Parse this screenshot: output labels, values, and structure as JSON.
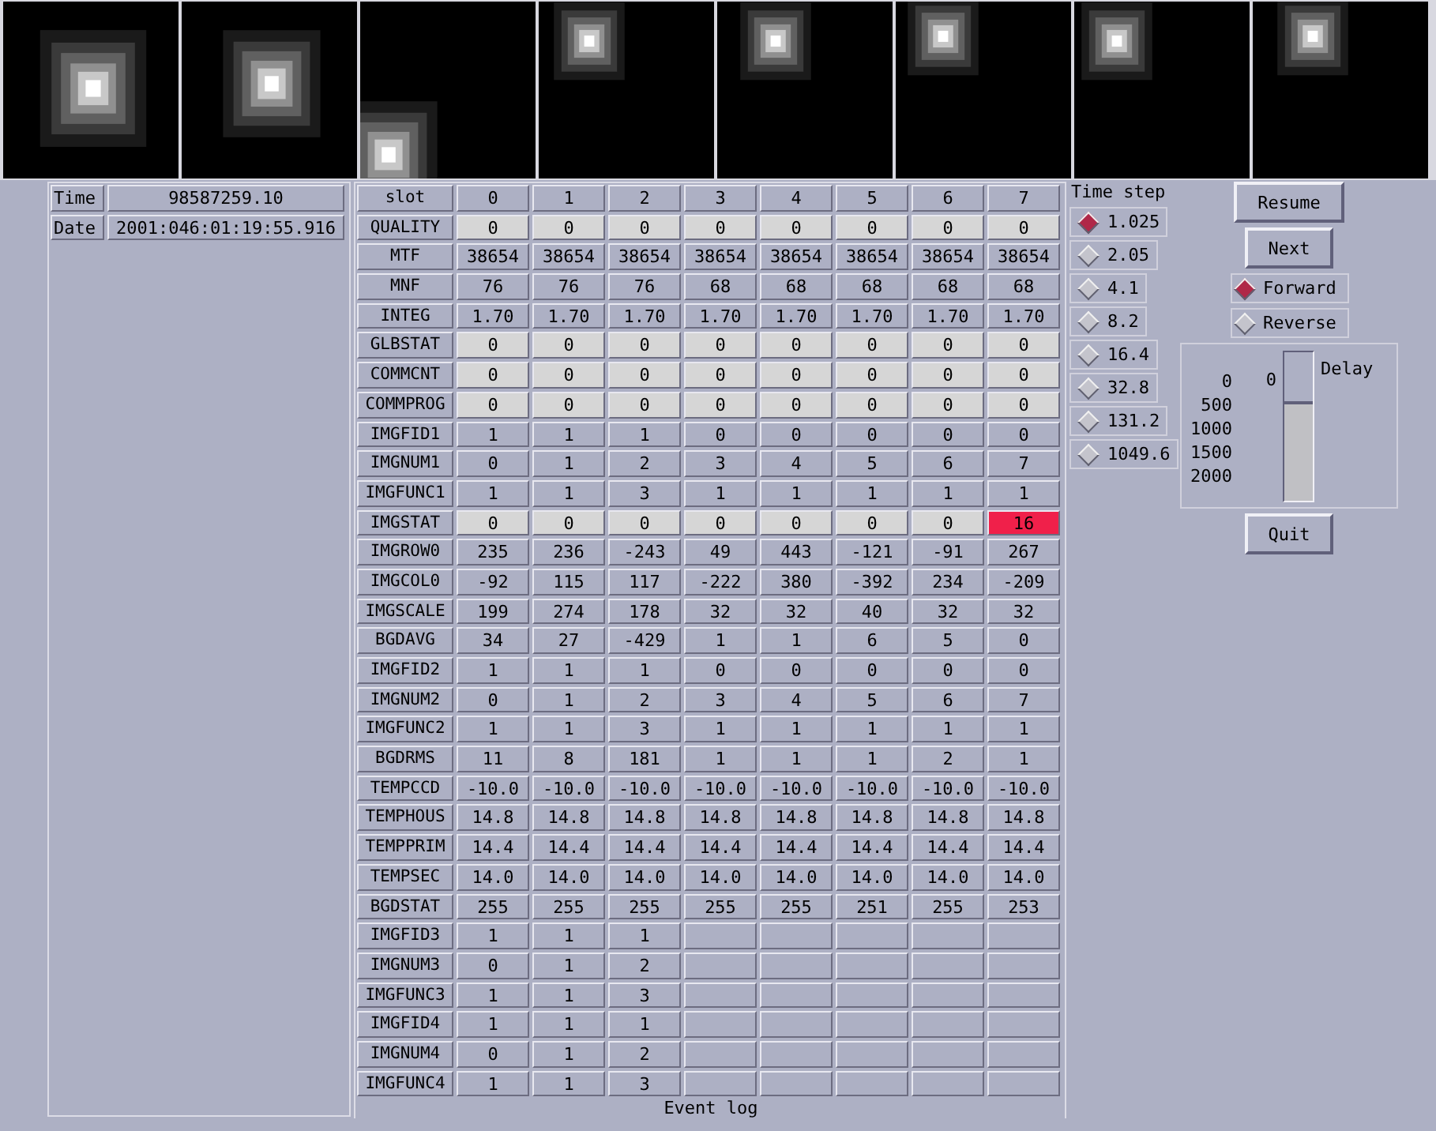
{
  "images": [
    {
      "kind": "picture"
    },
    {
      "kind": "picture"
    },
    {
      "kind": "picture"
    },
    {
      "kind": "picture"
    },
    {
      "kind": "picture"
    },
    {
      "kind": "picture"
    },
    {
      "kind": "picture"
    },
    {
      "kind": "picture"
    }
  ],
  "info": [
    {
      "label": "Time",
      "value": "98587259.10"
    },
    {
      "label": "Date",
      "value": "2001:046:01:19:55.916"
    }
  ],
  "table": {
    "header": {
      "label": "slot",
      "cells": [
        "0",
        "1",
        "2",
        "3",
        "4",
        "5",
        "6",
        "7"
      ]
    },
    "rows": [
      {
        "label": "QUALITY",
        "kind": "status",
        "cells": [
          {
            "text": "0",
            "alarm": false
          },
          {
            "text": "0",
            "alarm": false
          },
          {
            "text": "0",
            "alarm": false
          },
          {
            "text": "0",
            "alarm": false
          },
          {
            "text": "0",
            "alarm": false
          },
          {
            "text": "0",
            "alarm": false
          },
          {
            "text": "0",
            "alarm": false
          },
          {
            "text": "0",
            "alarm": false
          }
        ]
      },
      {
        "label": "MTF",
        "kind": "value",
        "cells": [
          "38654",
          "38654",
          "38654",
          "38654",
          "38654",
          "38654",
          "38654",
          "38654"
        ]
      },
      {
        "label": "MNF",
        "kind": "value",
        "cells": [
          "76",
          "76",
          "76",
          "68",
          "68",
          "68",
          "68",
          "68"
        ]
      },
      {
        "label": "INTEG",
        "kind": "value",
        "cells": [
          "1.70",
          "1.70",
          "1.70",
          "1.70",
          "1.70",
          "1.70",
          "1.70",
          "1.70"
        ]
      },
      {
        "label": "GLBSTAT",
        "kind": "status",
        "cells": [
          {
            "text": "0",
            "alarm": false
          },
          {
            "text": "0",
            "alarm": false
          },
          {
            "text": "0",
            "alarm": false
          },
          {
            "text": "0",
            "alarm": false
          },
          {
            "text": "0",
            "alarm": false
          },
          {
            "text": "0",
            "alarm": false
          },
          {
            "text": "0",
            "alarm": false
          },
          {
            "text": "0",
            "alarm": false
          }
        ]
      },
      {
        "label": "COMMCNT",
        "kind": "status",
        "cells": [
          {
            "text": "0",
            "alarm": false
          },
          {
            "text": "0",
            "alarm": false
          },
          {
            "text": "0",
            "alarm": false
          },
          {
            "text": "0",
            "alarm": false
          },
          {
            "text": "0",
            "alarm": false
          },
          {
            "text": "0",
            "alarm": false
          },
          {
            "text": "0",
            "alarm": false
          },
          {
            "text": "0",
            "alarm": false
          }
        ]
      },
      {
        "label": "COMMPROG",
        "kind": "status",
        "cells": [
          {
            "text": "0",
            "alarm": false
          },
          {
            "text": "0",
            "alarm": false
          },
          {
            "text": "0",
            "alarm": false
          },
          {
            "text": "0",
            "alarm": false
          },
          {
            "text": "0",
            "alarm": false
          },
          {
            "text": "0",
            "alarm": false
          },
          {
            "text": "0",
            "alarm": false
          },
          {
            "text": "0",
            "alarm": false
          }
        ]
      },
      {
        "label": "IMGFID1",
        "kind": "value",
        "cells": [
          "1",
          "1",
          "1",
          "0",
          "0",
          "0",
          "0",
          "0"
        ]
      },
      {
        "label": "IMGNUM1",
        "kind": "value",
        "cells": [
          "0",
          "1",
          "2",
          "3",
          "4",
          "5",
          "6",
          "7"
        ]
      },
      {
        "label": "IMGFUNC1",
        "kind": "value",
        "cells": [
          "1",
          "1",
          "3",
          "1",
          "1",
          "1",
          "1",
          "1"
        ]
      },
      {
        "label": "IMGSTAT",
        "kind": "status",
        "cells": [
          {
            "text": "0",
            "alarm": false
          },
          {
            "text": "0",
            "alarm": false
          },
          {
            "text": "0",
            "alarm": false
          },
          {
            "text": "0",
            "alarm": false
          },
          {
            "text": "0",
            "alarm": false
          },
          {
            "text": "0",
            "alarm": false
          },
          {
            "text": "0",
            "alarm": false
          },
          {
            "text": "16",
            "alarm": true
          }
        ]
      },
      {
        "label": "IMGROW0",
        "kind": "value",
        "cells": [
          "235",
          "236",
          "-243",
          "49",
          "443",
          "-121",
          "-91",
          "267"
        ]
      },
      {
        "label": "IMGCOL0",
        "kind": "value",
        "cells": [
          "-92",
          "115",
          "117",
          "-222",
          "380",
          "-392",
          "234",
          "-209"
        ]
      },
      {
        "label": "IMGSCALE",
        "kind": "value",
        "cells": [
          "199",
          "274",
          "178",
          "32",
          "32",
          "40",
          "32",
          "32"
        ]
      },
      {
        "label": "BGDAVG",
        "kind": "value",
        "cells": [
          "34",
          "27",
          "-429",
          "1",
          "1",
          "6",
          "5",
          "0"
        ]
      },
      {
        "label": "IMGFID2",
        "kind": "value",
        "cells": [
          "1",
          "1",
          "1",
          "0",
          "0",
          "0",
          "0",
          "0"
        ]
      },
      {
        "label": "IMGNUM2",
        "kind": "value",
        "cells": [
          "0",
          "1",
          "2",
          "3",
          "4",
          "5",
          "6",
          "7"
        ]
      },
      {
        "label": "IMGFUNC2",
        "kind": "value",
        "cells": [
          "1",
          "1",
          "3",
          "1",
          "1",
          "1",
          "1",
          "1"
        ]
      },
      {
        "label": "BGDRMS",
        "kind": "value",
        "cells": [
          "11",
          "8",
          "181",
          "1",
          "1",
          "1",
          "2",
          "1"
        ]
      },
      {
        "label": "TEMPCCD",
        "kind": "value",
        "cells": [
          "-10.0",
          "-10.0",
          "-10.0",
          "-10.0",
          "-10.0",
          "-10.0",
          "-10.0",
          "-10.0"
        ]
      },
      {
        "label": "TEMPHOUS",
        "kind": "value",
        "cells": [
          "14.8",
          "14.8",
          "14.8",
          "14.8",
          "14.8",
          "14.8",
          "14.8",
          "14.8"
        ]
      },
      {
        "label": "TEMPPRIM",
        "kind": "value",
        "cells": [
          "14.4",
          "14.4",
          "14.4",
          "14.4",
          "14.4",
          "14.4",
          "14.4",
          "14.4"
        ]
      },
      {
        "label": "TEMPSEC",
        "kind": "value",
        "cells": [
          "14.0",
          "14.0",
          "14.0",
          "14.0",
          "14.0",
          "14.0",
          "14.0",
          "14.0"
        ]
      },
      {
        "label": "BGDSTAT",
        "kind": "value",
        "cells": [
          "255",
          "255",
          "255",
          "255",
          "255",
          "251",
          "255",
          "253"
        ]
      },
      {
        "label": "IMGFID3",
        "kind": "value",
        "cells": [
          "1",
          "1",
          "1"
        ]
      },
      {
        "label": "IMGNUM3",
        "kind": "value",
        "cells": [
          "0",
          "1",
          "2"
        ]
      },
      {
        "label": "IMGFUNC3",
        "kind": "value",
        "cells": [
          "1",
          "1",
          "3"
        ]
      },
      {
        "label": "IMGFID4",
        "kind": "value",
        "cells": [
          "1",
          "1",
          "1"
        ]
      },
      {
        "label": "IMGNUM4",
        "kind": "value",
        "cells": [
          "0",
          "1",
          "2"
        ]
      },
      {
        "label": "IMGFUNC4",
        "kind": "value",
        "cells": [
          "1",
          "1",
          "3"
        ]
      }
    ]
  },
  "event_log": {
    "title": "Event log"
  },
  "time_step": {
    "title": "Time step",
    "options": [
      {
        "label": "1.025",
        "selected": true
      },
      {
        "label": "2.05",
        "selected": false
      },
      {
        "label": "4.1",
        "selected": false
      },
      {
        "label": "8.2",
        "selected": false
      },
      {
        "label": "16.4",
        "selected": false
      },
      {
        "label": "32.8",
        "selected": false
      },
      {
        "label": "131.2",
        "selected": false
      },
      {
        "label": "1049.6",
        "selected": false
      }
    ]
  },
  "buttons_top": [
    "Resume",
    "Next"
  ],
  "direction": [
    {
      "label": "Forward",
      "selected": true
    },
    {
      "label": "Reverse",
      "selected": false
    }
  ],
  "delay": {
    "label": "Delay",
    "value": "0",
    "level": 0,
    "ticks": [
      "0",
      "500",
      "1000",
      "1500",
      "2000"
    ]
  },
  "buttons_bottom": [
    "Quit"
  ]
}
